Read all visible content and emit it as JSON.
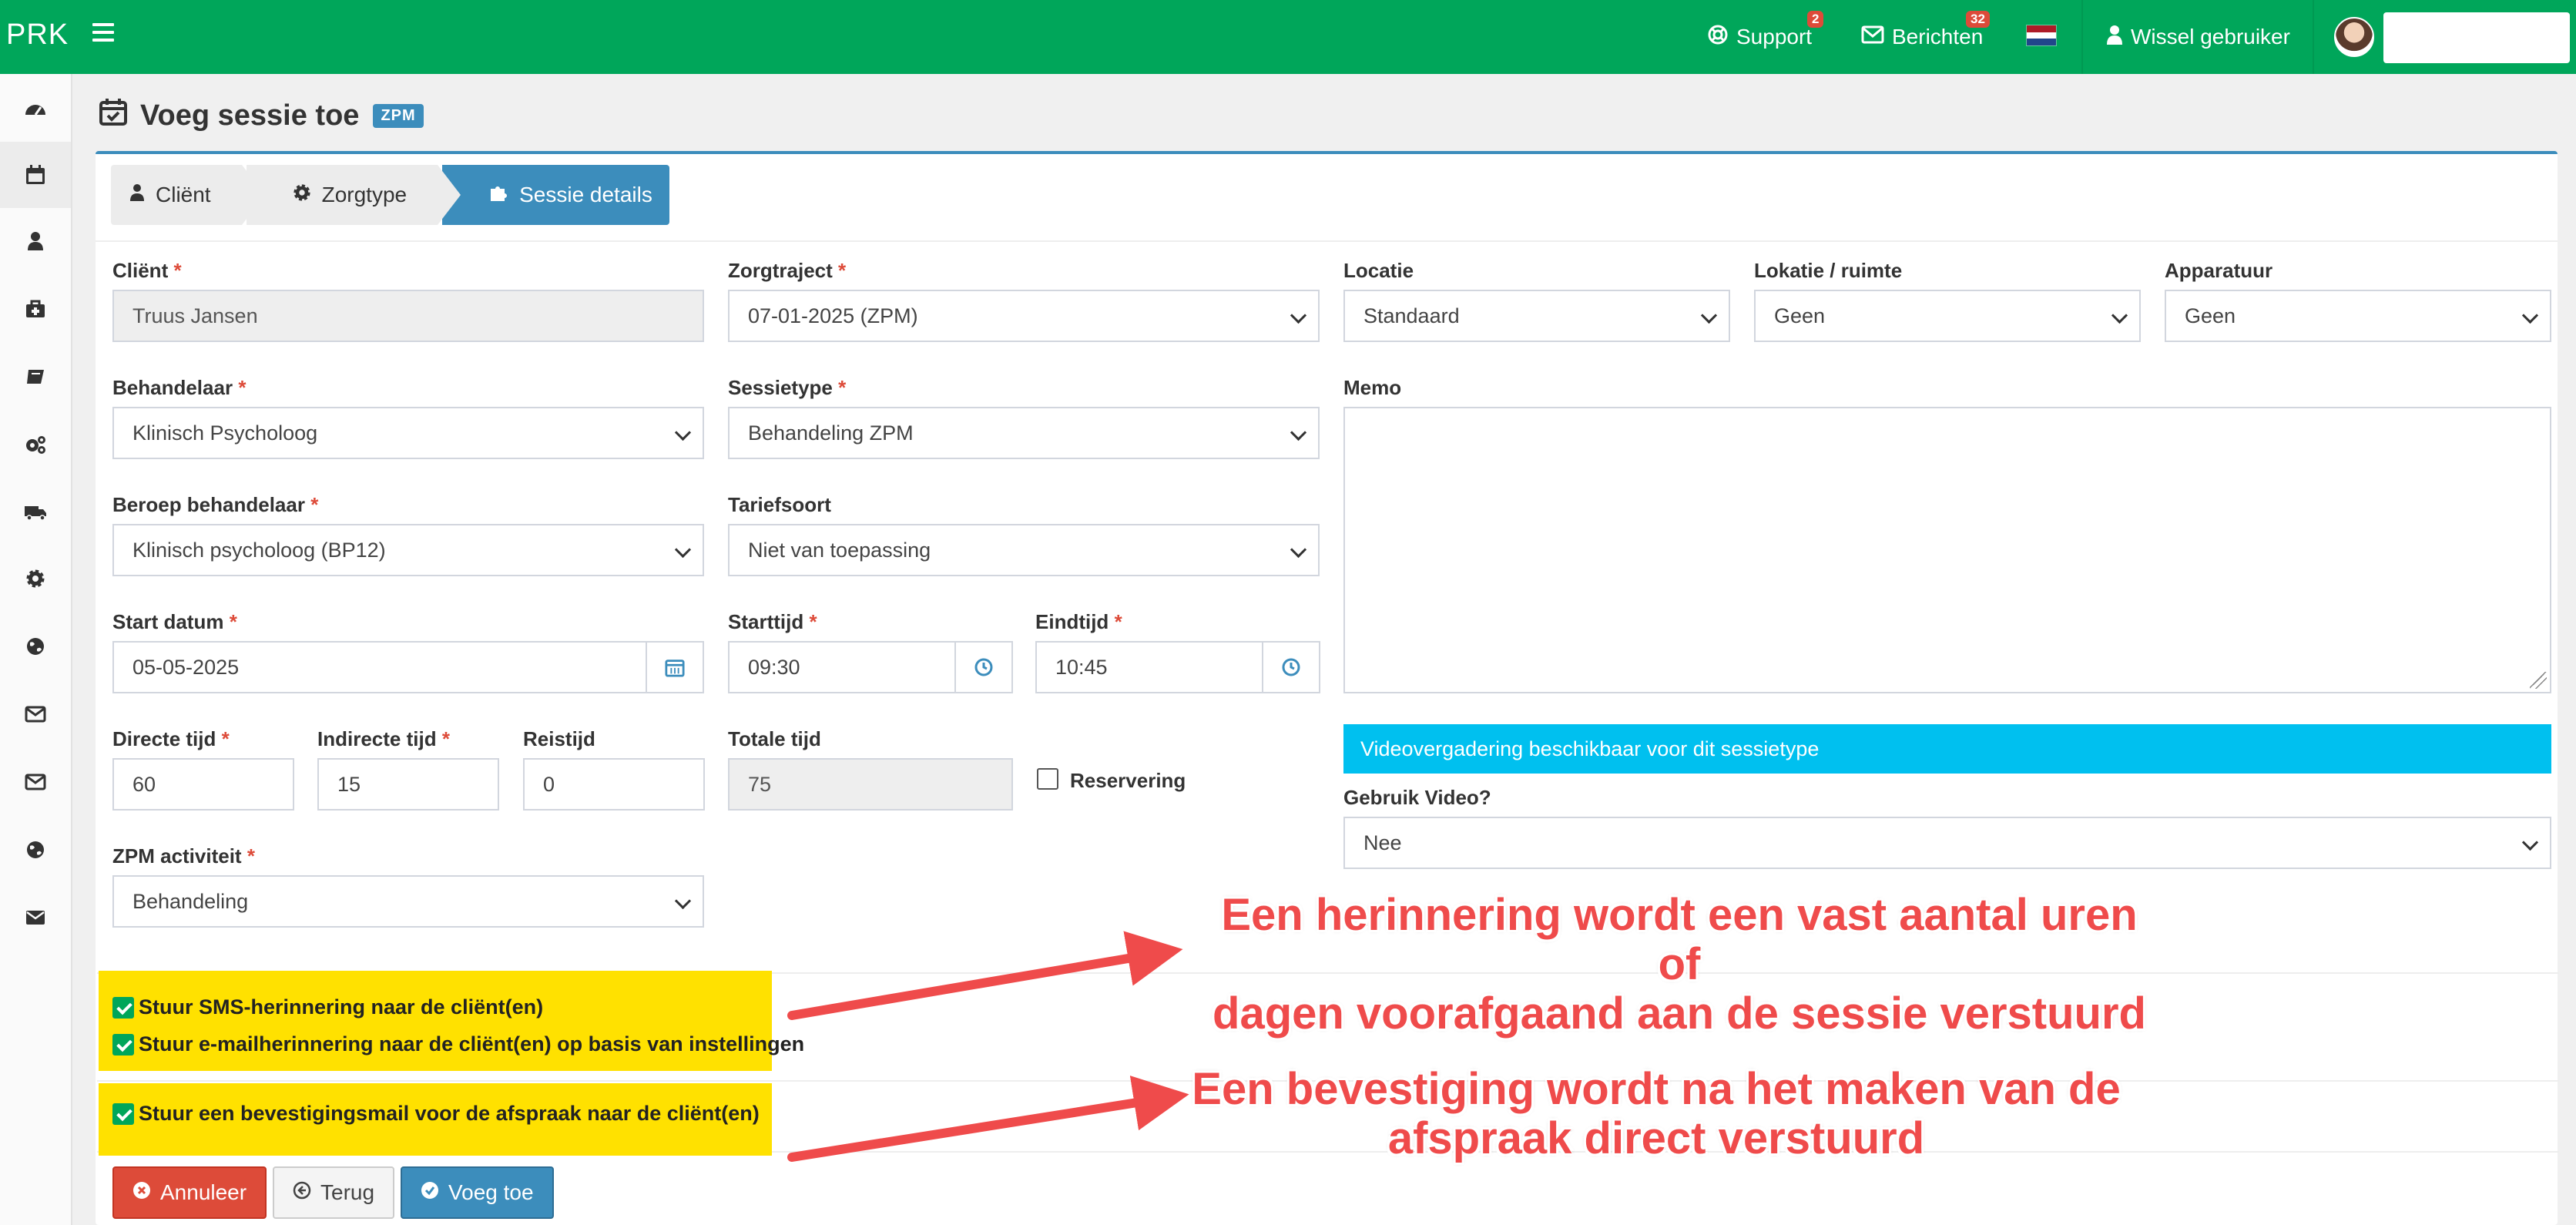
{
  "topbar": {
    "logo": "PRK",
    "support": {
      "label": "Support",
      "badge": "2",
      "icon": "lifebuoy-icon"
    },
    "messages": {
      "label": "Berichten",
      "badge": "32",
      "icon": "envelope-icon"
    },
    "language_flag": "netherlands-flag",
    "switch_user": {
      "label": "Wissel gebruiker",
      "icon": "user-secret-icon"
    }
  },
  "sidebar": {
    "items": [
      {
        "icon": "dashboard-icon"
      },
      {
        "icon": "calendar-icon"
      },
      {
        "icon": "user-icon"
      },
      {
        "icon": "medkit-icon"
      },
      {
        "icon": "book-icon"
      },
      {
        "icon": "cogs-icon"
      },
      {
        "icon": "truck-icon"
      },
      {
        "icon": "gear-icon"
      },
      {
        "icon": "globe-icon"
      },
      {
        "icon": "envelope-o-icon"
      },
      {
        "icon": "envelope-o-icon"
      },
      {
        "icon": "globe-icon"
      },
      {
        "icon": "envelope-icon"
      }
    ]
  },
  "page": {
    "title": "Voeg sessie toe",
    "label": "ZPM"
  },
  "wizard": {
    "steps": [
      {
        "label": "Cliënt",
        "icon": "user-icon"
      },
      {
        "label": "Zorgtype",
        "icon": "gear-icon"
      },
      {
        "label": "Sessie details",
        "icon": "puzzle-icon",
        "active": true
      }
    ]
  },
  "form": {
    "client": {
      "label": "Cliënt",
      "value": "Truus Jansen"
    },
    "zorgtraject": {
      "label": "Zorgtraject",
      "value": "07-01-2025 (ZPM)"
    },
    "locatie": {
      "label": "Locatie",
      "value": "Standaard"
    },
    "lokatie_ruimte": {
      "label": "Lokatie / ruimte",
      "value": "Geen"
    },
    "apparatuur": {
      "label": "Apparatuur",
      "value": "Geen"
    },
    "behandelaar": {
      "label": "Behandelaar",
      "value": "Klinisch Psycholoog"
    },
    "sessietype": {
      "label": "Sessietype",
      "value": "Behandeling ZPM"
    },
    "memo": {
      "label": "Memo",
      "value": ""
    },
    "beroep": {
      "label": "Beroep behandelaar",
      "value": "Klinisch psycholoog (BP12)"
    },
    "tariefsoort": {
      "label": "Tariefsoort",
      "value": "Niet van toepassing"
    },
    "start_datum": {
      "label": "Start datum",
      "value": "05-05-2025"
    },
    "starttijd": {
      "label": "Starttijd",
      "value": "09:30"
    },
    "eindtijd": {
      "label": "Eindtijd",
      "value": "10:45"
    },
    "directe_tijd": {
      "label": "Directe tijd",
      "value": "60"
    },
    "indirecte_tijd": {
      "label": "Indirecte tijd",
      "value": "15"
    },
    "reistijd": {
      "label": "Reistijd",
      "value": "0"
    },
    "totale_tijd": {
      "label": "Totale tijd",
      "value": "75"
    },
    "reservering": {
      "label": "Reservering",
      "checked": false
    },
    "video_notice": "Videovergadering beschikbaar voor dit sessietype",
    "gebruik_video": {
      "label": "Gebruik Video?",
      "value": "Nee"
    },
    "zpm_activiteit": {
      "label": "ZPM activiteit",
      "value": "Behandeling"
    },
    "sms_reminder": {
      "label": "Stuur SMS-herinnering naar de cliënt(en)",
      "checked": true
    },
    "email_reminder": {
      "label": "Stuur e-mailherinnering naar de cliënt(en) op basis van instellingen",
      "checked": true
    },
    "confirmation": {
      "label": "Stuur een bevestigingsmail voor de afspraak naar de cliënt(en)",
      "checked": true
    }
  },
  "buttons": {
    "cancel": "Annuleer",
    "back": "Terug",
    "add": "Voeg toe"
  },
  "annotations": {
    "reminder_line1": "Een herinnering wordt een vast aantal uren of",
    "reminder_line2": "dagen voorafgaand aan de sessie verstuurd",
    "confirm_line1": "Een bevestiging wordt na het maken van de",
    "confirm_line2": "afspraak direct verstuurd",
    "color": "#ef4b4b"
  },
  "colors": {
    "topbar": "#00a65a",
    "primary": "#3c8dbc",
    "danger": "#dd4b39",
    "info": "#00c0ef",
    "highlight": "#ffe100"
  }
}
